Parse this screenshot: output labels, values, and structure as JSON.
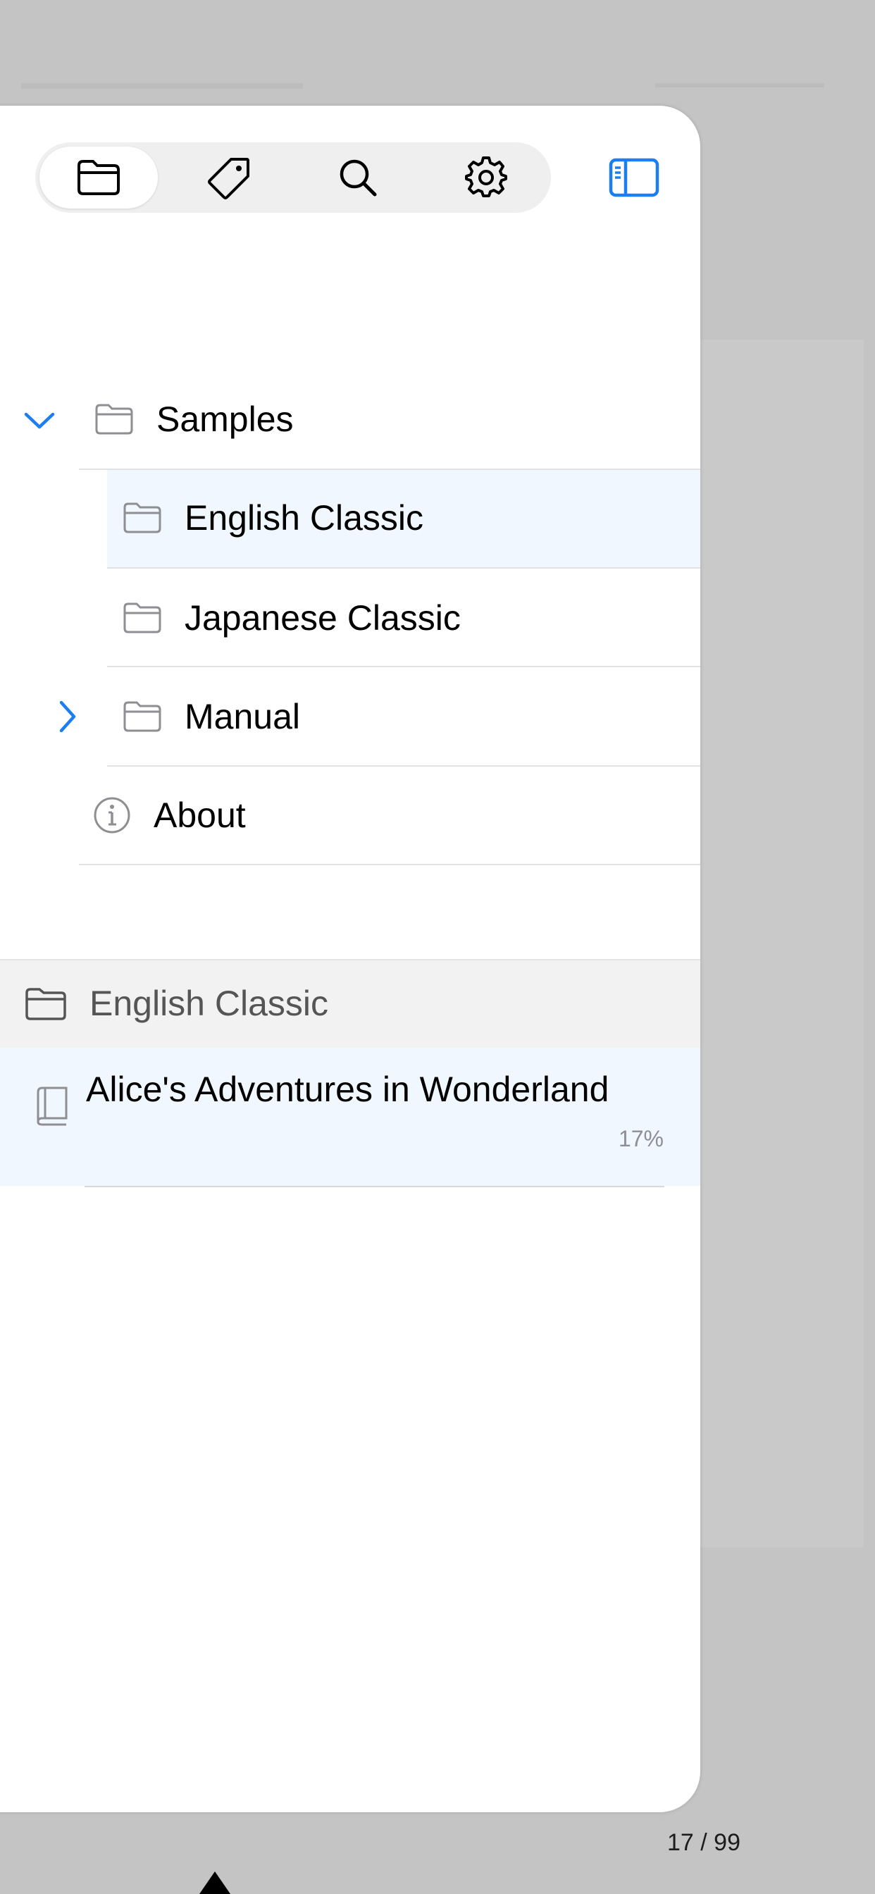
{
  "toolbar": {
    "tabs": [
      {
        "icon": "folder-icon",
        "active": true
      },
      {
        "icon": "tag-icon",
        "active": false
      },
      {
        "icon": "search-icon",
        "active": false
      },
      {
        "icon": "gear-icon",
        "active": false
      }
    ],
    "sidebar_toggle_icon": "sidebar-icon"
  },
  "tree": {
    "root": {
      "label": "Samples",
      "expanded": true
    },
    "children": [
      {
        "label": "English Classic",
        "selected": true
      },
      {
        "label": "Japanese Classic",
        "selected": false
      },
      {
        "label": "Manual",
        "expandable": true
      }
    ],
    "about": {
      "label": "About"
    }
  },
  "section": {
    "title": "English Classic"
  },
  "books": [
    {
      "title": "Alice's Adventures in Wonderland",
      "progress": "17%"
    }
  ],
  "page_indicator": "17 / 99",
  "colors": {
    "accent": "#1c7ef2",
    "selected_row": "#f0f7fe",
    "icon_gray": "#8e8e93"
  }
}
